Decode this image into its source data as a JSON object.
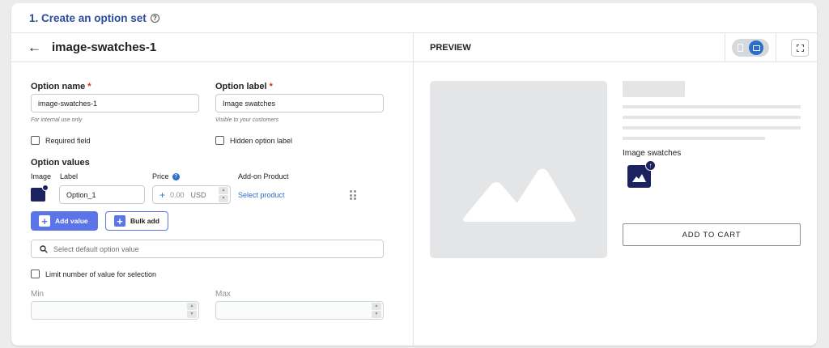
{
  "section": {
    "title": "1. Create an option set"
  },
  "option_set": {
    "name": "image-swatches-1"
  },
  "form": {
    "option_name_label": "Option name",
    "option_name_value": "image-swatches-1",
    "option_name_hint": "For internal use only",
    "option_label_label": "Option label",
    "option_label_value": "Image swatches",
    "option_label_hint": "Visible to your customers",
    "required_asterisk": "*",
    "required_field_label": "Required field",
    "required_field_checked": false,
    "hidden_label_label": "Hidden option label",
    "hidden_label_checked": false,
    "values_title": "Option values",
    "columns": {
      "image": "Image",
      "label": "Label",
      "price": "Price",
      "addon": "Add-on Product"
    },
    "values": [
      {
        "label": "Option_1",
        "price_prefix": "+",
        "price_placeholder": "0.00",
        "currency": "USD",
        "addon_link": "Select product"
      }
    ],
    "add_value_label": "Add value",
    "bulk_add_label": "Bulk add",
    "default_value_placeholder": "Select default option value",
    "limit_label": "Limit number of value for selection",
    "limit_checked": false,
    "min_label": "Min",
    "max_label": "Max"
  },
  "preview": {
    "title": "PREVIEW",
    "option_label": "Image swatches",
    "add_to_cart_label": "ADD TO CART",
    "device_mode": "desktop"
  },
  "colors": {
    "accent": "#5b74e7",
    "link": "#2c6ecb",
    "title": "#2c4b9c",
    "swatch": "#1c2260",
    "required": "#d72c0d"
  },
  "icons": [
    "help-icon",
    "back-arrow-icon",
    "info-icon",
    "image-icon",
    "plus-icon",
    "search-icon",
    "drag-handle-icon",
    "mobile-icon",
    "desktop-icon",
    "fullscreen-icon",
    "upload-icon",
    "image-placeholder-icon"
  ]
}
